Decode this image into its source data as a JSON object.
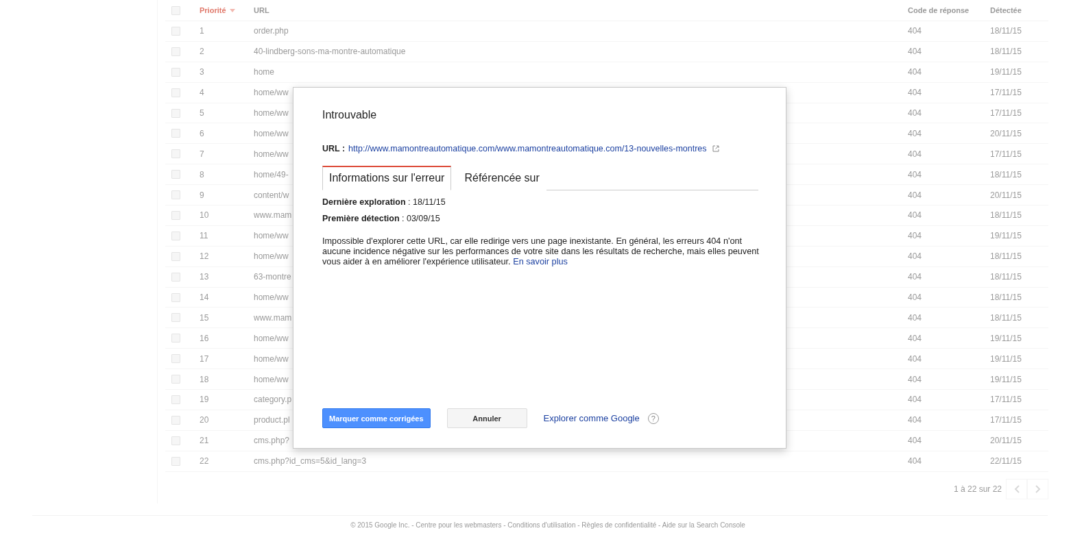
{
  "table": {
    "header_checkbox": {
      "checked": false
    },
    "columns": [
      {
        "label": "Priorité",
        "sorted": true
      },
      {
        "label": "URL",
        "sorted": false
      },
      {
        "label": "Code de réponse",
        "sorted": false
      },
      {
        "label": "Détectée",
        "sorted": false
      }
    ],
    "rows": [
      {
        "checked": false,
        "priority": "1",
        "url": "order.php",
        "code": "404",
        "detected": "18/11/15"
      },
      {
        "checked": false,
        "priority": "2",
        "url": "40-lindberg-sons-ma-montre-automatique",
        "code": "404",
        "detected": "18/11/15"
      },
      {
        "checked": false,
        "priority": "3",
        "url": "home",
        "code": "404",
        "detected": "19/11/15"
      },
      {
        "checked": false,
        "priority": "4",
        "url": "home/ww",
        "code": "404",
        "detected": "17/11/15"
      },
      {
        "checked": false,
        "priority": "5",
        "url": "home/ww",
        "code": "404",
        "detected": "17/11/15"
      },
      {
        "checked": false,
        "priority": "6",
        "url": "home/ww",
        "code": "404",
        "detected": "20/11/15"
      },
      {
        "checked": false,
        "priority": "7",
        "url": "home/ww",
        "code": "404",
        "detected": "17/11/15"
      },
      {
        "checked": false,
        "priority": "8",
        "url": "home/49-",
        "code": "404",
        "detected": "18/11/15"
      },
      {
        "checked": false,
        "priority": "9",
        "url": "content/w",
        "code": "404",
        "detected": "20/11/15"
      },
      {
        "checked": false,
        "priority": "10",
        "url": "www.mam",
        "code": "404",
        "detected": "18/11/15"
      },
      {
        "checked": false,
        "priority": "11",
        "url": "home/ww",
        "code": "404",
        "detected": "19/11/15"
      },
      {
        "checked": false,
        "priority": "12",
        "url": "home/ww",
        "code": "404",
        "detected": "18/11/15"
      },
      {
        "checked": false,
        "priority": "13",
        "url": "63-montre",
        "code": "404",
        "detected": "18/11/15"
      },
      {
        "checked": false,
        "priority": "14",
        "url": "home/ww",
        "code": "404",
        "detected": "18/11/15"
      },
      {
        "checked": false,
        "priority": "15",
        "url": "www.mam",
        "code": "404",
        "detected": "18/11/15"
      },
      {
        "checked": false,
        "priority": "16",
        "url": "home/ww",
        "code": "404",
        "detected": "19/11/15"
      },
      {
        "checked": false,
        "priority": "17",
        "url": "home/ww",
        "code": "404",
        "detected": "19/11/15"
      },
      {
        "checked": false,
        "priority": "18",
        "url": "home/ww",
        "code": "404",
        "detected": "19/11/15"
      },
      {
        "checked": false,
        "priority": "19",
        "url": "category.p",
        "code": "404",
        "detected": "17/11/15"
      },
      {
        "checked": false,
        "priority": "20",
        "url": "product.pl",
        "code": "404",
        "detected": "17/11/15"
      },
      {
        "checked": false,
        "priority": "21",
        "url": "cms.php?",
        "code": "404",
        "detected": "20/11/15"
      },
      {
        "checked": false,
        "priority": "22",
        "url": "cms.php?id_cms=5&id_lang=3",
        "code": "404",
        "detected": "22/11/15"
      }
    ],
    "pagination": "1 à 22 sur 22"
  },
  "dialog": {
    "title": "Introuvable",
    "url_label": "URL :",
    "url": "http://www.mamontreautomatique.com/www.mamontreautomatique.com/13-nouvelles-montres",
    "tabs": [
      {
        "label": "Informations sur l'erreur",
        "selected": true
      },
      {
        "label": "Référencée sur",
        "selected": false
      }
    ],
    "details": [
      {
        "label": "Dernière exploration",
        "value": ": 18/11/15"
      },
      {
        "label": "Première détection",
        "value": ": 03/09/15"
      }
    ],
    "description": "Impossible d'explorer cette URL, car elle redirige vers une page inexistante. En général, les erreurs 404 n'ont aucune incidence négative sur les performances de votre site dans les résultats de recherche, mais elles peuvent vous aider à en améliorer l'expérience utilisateur.",
    "learn_more": "En savoir plus",
    "primary_button": "Marquer comme corrigées",
    "cancel_button": "Annuler",
    "fetch_link": "Explorer comme Google",
    "help_icon": "?"
  },
  "footer": "© 2015 Google Inc. - Centre pour les webmasters - Conditions d'utilisation - Règles de confidentialité - Aide sur la Search Console"
}
